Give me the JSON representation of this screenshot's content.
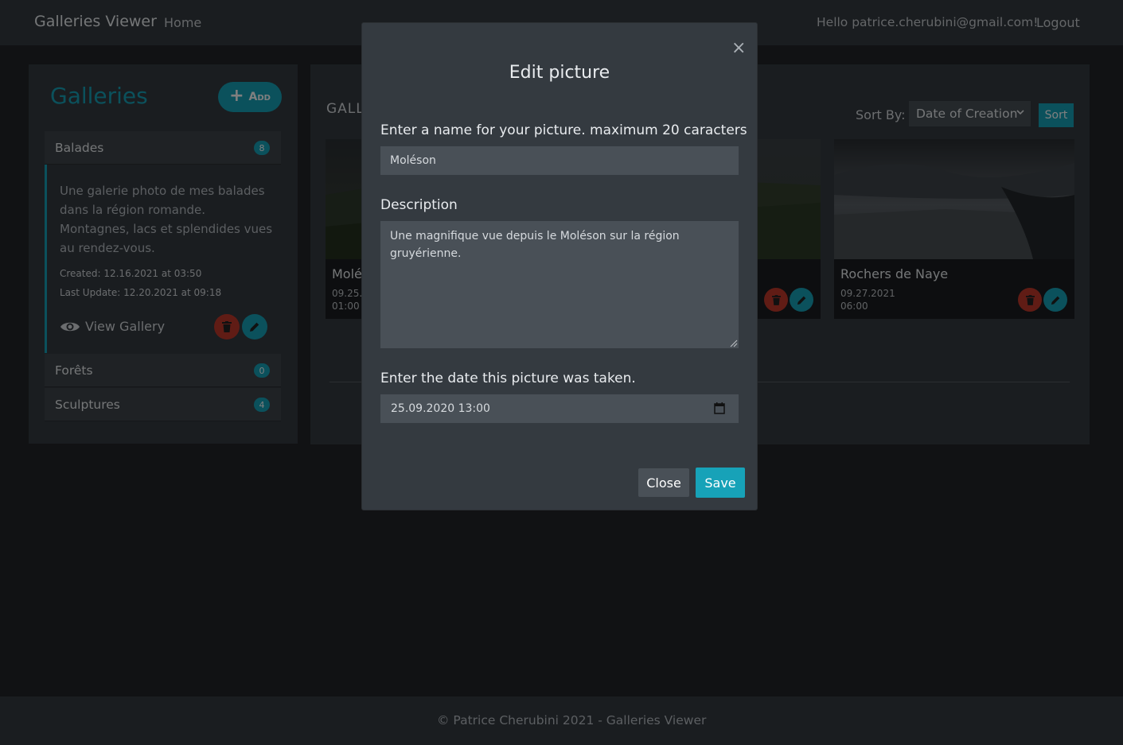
{
  "navbar": {
    "brand": "Galleries Viewer",
    "home": "Home",
    "greeting": "Hello patrice.cherubini@gmail.com!",
    "logout": "Logout"
  },
  "sidebar": {
    "title": "Galleries",
    "add_label": "Add",
    "galleries": [
      {
        "name": "Balades",
        "count": "8",
        "description": "Une galerie photo de mes balades dans la région romande. Montagnes, lacs et splendides vues au rendez-vous.",
        "created": "Created: 12.16.2021 at 03:50",
        "updated": "Last Update: 12.20.2021 at 09:18",
        "view_label": "View Gallery"
      },
      {
        "name": "Forêts",
        "count": "0"
      },
      {
        "name": "Sculptures",
        "count": "4"
      }
    ]
  },
  "main": {
    "heading": "GALL",
    "sort_label": "Sort By:",
    "sort_value": "Date of Creation",
    "sort_button": "Sort",
    "pictures": [
      {
        "title": "Molé",
        "date": "09.25.2",
        "time": "01:00"
      },
      {
        "title": "",
        "date": "",
        "time": ""
      },
      {
        "title": "Rochers de Naye",
        "date": "09.27.2021",
        "time": "06:00"
      }
    ]
  },
  "footer": {
    "text": "© Patrice Cherubini 2021 - Galleries Viewer"
  },
  "modal": {
    "title": "Edit picture",
    "name_label": "Enter a name for your picture. maximum 20 caracters",
    "name_value": "Moléson",
    "description_label": "Description",
    "description_value": "Une magnifique vue depuis le Moléson sur la région gruyérienne.",
    "date_label": "Enter the date this picture was taken.",
    "date_value": "25.09.2020 13:00",
    "close_button": "Close",
    "save_button": "Save"
  },
  "colors": {
    "accent": "#17a2b8",
    "danger": "#c0392b",
    "background": "#222529",
    "panel": "#343a40"
  }
}
